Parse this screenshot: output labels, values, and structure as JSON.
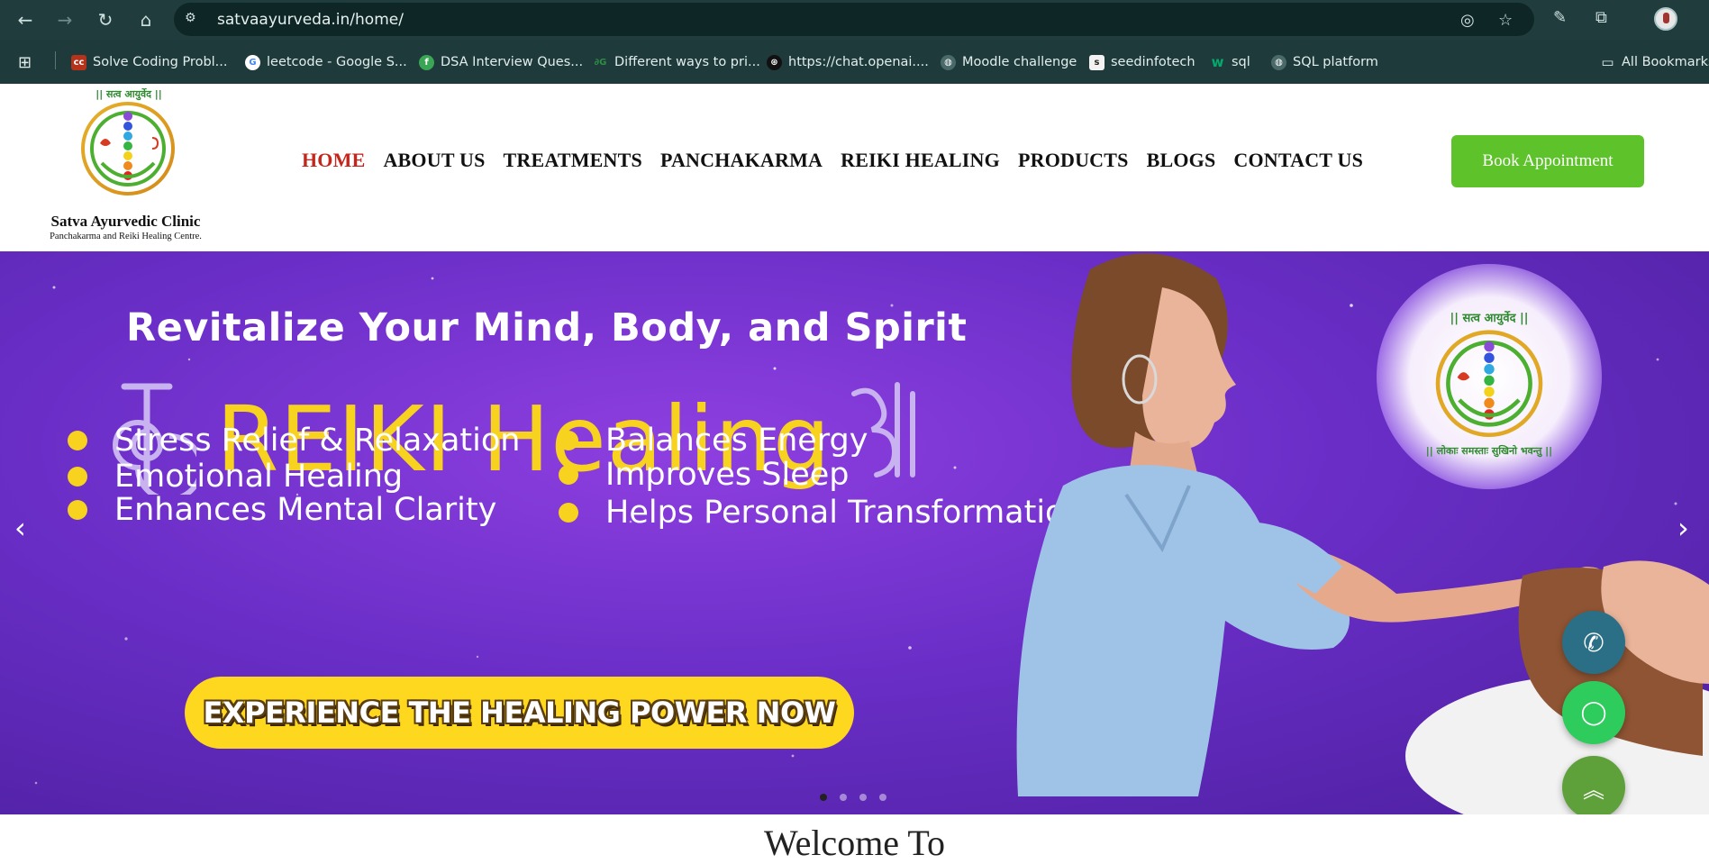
{
  "browser": {
    "url": "satvaayurveda.in/home/",
    "bookmarks": [
      {
        "label": "Solve Coding Probl...",
        "icon": "cc-icon",
        "color": "#b5331b",
        "glyph": "cc"
      },
      {
        "label": "leetcode - Google S...",
        "icon": "google-icon",
        "color": "#ffffff",
        "glyph": "G"
      },
      {
        "label": "DSA Interview Ques...",
        "icon": "dsa-icon",
        "color": "#3aa655",
        "glyph": "f"
      },
      {
        "label": "Different ways to pri...",
        "icon": "gfg-icon",
        "color": "#2f8d46",
        "glyph": "gg"
      },
      {
        "label": "https://chat.openai....",
        "icon": "openai-icon",
        "color": "#111111",
        "glyph": "⊛"
      },
      {
        "label": "Moodle challenge",
        "icon": "globe-icon",
        "color": "#4a6a6a",
        "glyph": "◍"
      },
      {
        "label": "seedinfotech",
        "icon": "seed-icon",
        "color": "#f2f2f2",
        "glyph": "s"
      },
      {
        "label": "sql",
        "icon": "w3-icon",
        "color": "#04aa6d",
        "glyph": "w"
      },
      {
        "label": "SQL platform",
        "icon": "globe-icon",
        "color": "#4a6a6a",
        "glyph": "◍"
      }
    ],
    "all_bookmarks": "All Bookmarks"
  },
  "site": {
    "logo_top": "|| सत्व आयुर्वेद ||",
    "logo_ring_text": "|| लोकाः समस्ताः सुखिनो भवन्तु ||",
    "clinic_name": "Satva Ayurvedic Clinic",
    "clinic_sub": "Panchakarma and Reiki Healing Centre.",
    "menu": [
      "HOME",
      "ABOUT US",
      "TREATMENTS",
      "PANCHAKARMA",
      "REIKI HEALING",
      "PRODUCTS",
      "BLOGS",
      "CONTACT US"
    ],
    "book_label": "Book Appointment",
    "colors": {
      "accent_green": "#5ec22b",
      "active_red": "#c2261c",
      "hero_purple": "#6a2ec7",
      "cta_yellow": "#fdd81f"
    }
  },
  "hero": {
    "tagline": "Revitalize Your Mind, Body, and Spirit",
    "title": "REIKI Healing",
    "benefits_left": [
      "Stress Relief & Relaxation",
      "Emotional Healing",
      "Enhances Mental Clarity"
    ],
    "benefits_right": [
      "Balances Energy",
      "Improves Sleep",
      "Helps Personal Transformation"
    ],
    "cta": "EXPERIENCE THE HEALING POWER NOW",
    "logo_top": "|| सत्व आयुर्वेद ||",
    "logo_ring_text": "|| लोकाः समस्ताः सुखिनो भवन्तु ||",
    "slide_count": 4,
    "active_slide": 1
  },
  "welcome": "Welcome To"
}
